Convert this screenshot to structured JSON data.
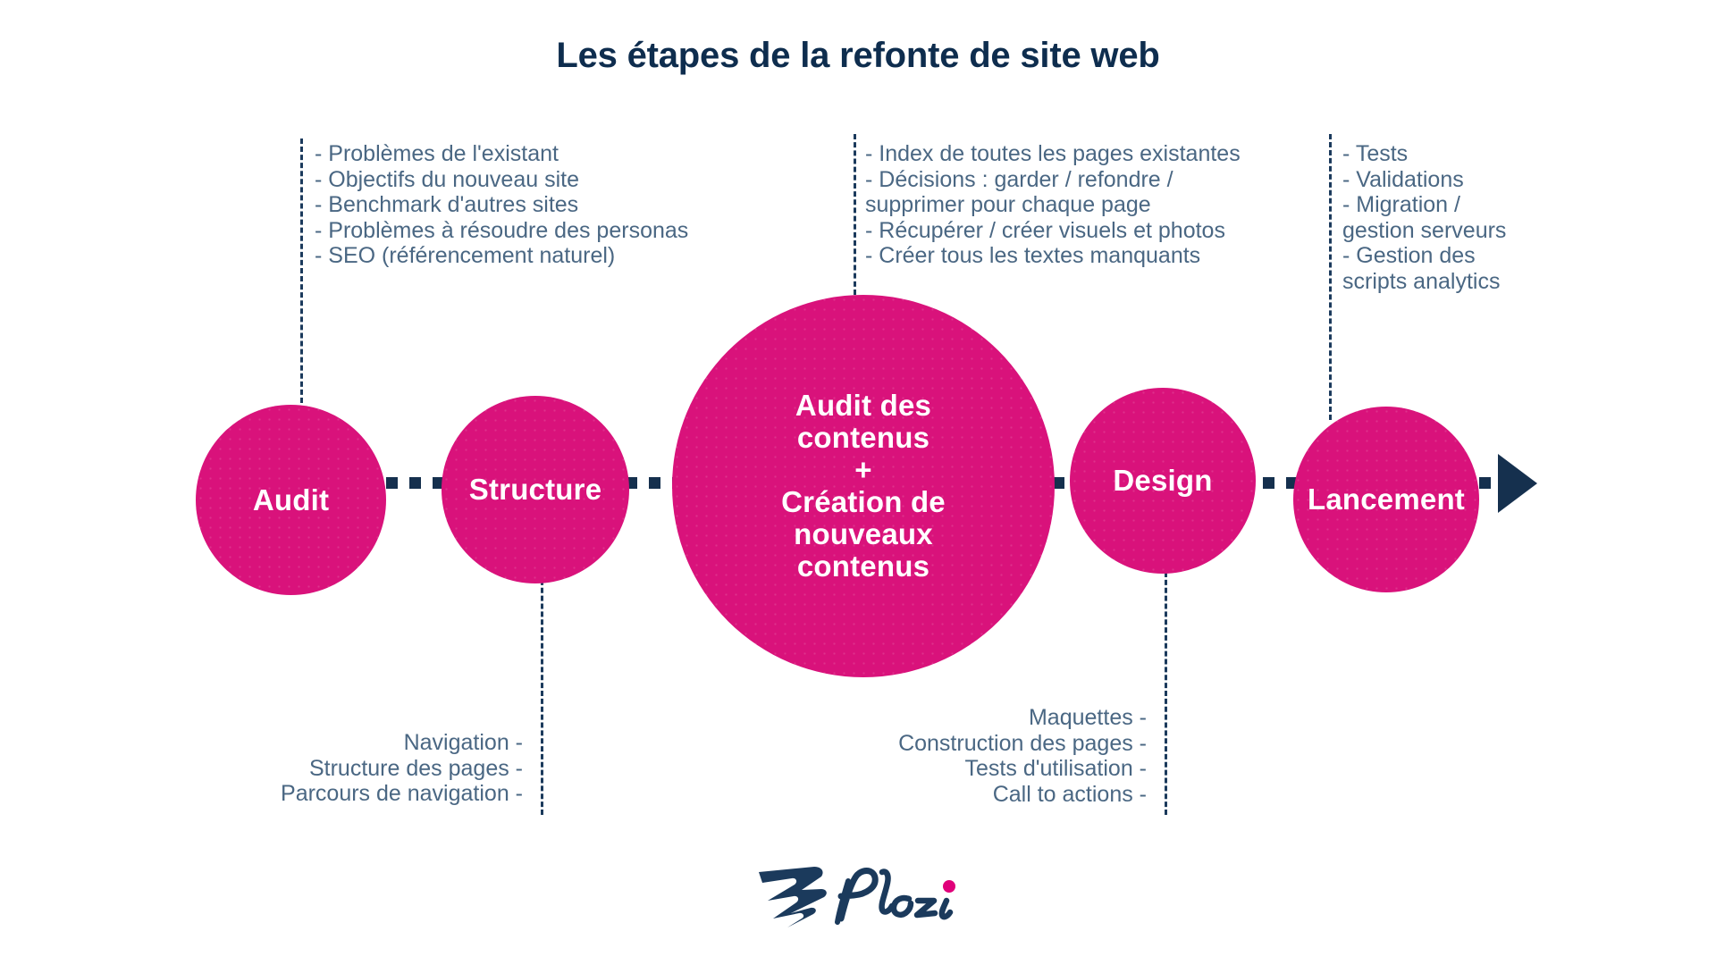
{
  "page": {
    "title": "Les étapes de la refonte de site web",
    "background_color": "#ffffff"
  },
  "colors": {
    "accent_pink": "#d9127b",
    "navy": "#15304e",
    "title_navy": "#0e2d4e",
    "note_text": "#4a6783"
  },
  "steps": [
    {
      "id": "audit",
      "label": "Audit",
      "size": "small"
    },
    {
      "id": "structure",
      "label": "Structure",
      "size": "small"
    },
    {
      "id": "contenus",
      "label": "Audit des\ncontenus\n+\nCréation de\nnouveaux\ncontenus",
      "size": "big"
    },
    {
      "id": "design",
      "label": "Design",
      "size": "small"
    },
    {
      "id": "lancement",
      "label": "Lancement",
      "size": "small"
    }
  ],
  "notes": {
    "audit": {
      "position": "above",
      "align": "left",
      "text": "- Problèmes de l'existant\n- Objectifs du nouveau site\n- Benchmark d'autres sites\n- Problèmes à résoudre des personas\n- SEO (référencement naturel)",
      "items": [
        "- Problèmes de l'existant",
        "- Objectifs du nouveau site",
        "- Benchmark d'autres sites",
        "- Problèmes à résoudre des personas",
        "- SEO (référencement naturel)"
      ]
    },
    "structure": {
      "position": "below",
      "align": "right",
      "text": "Navigation -\nStructure des pages -\nParcours de navigation -",
      "items": [
        "Navigation -",
        "Structure des pages -",
        "Parcours de navigation -"
      ]
    },
    "contenus": {
      "position": "above",
      "align": "left",
      "text": "- Index de toutes les pages existantes\n- Décisions : garder / refondre /\nsupprimer pour chaque page\n- Récupérer / créer visuels et photos\n- Créer tous les textes manquants",
      "items": [
        "- Index de toutes les pages existantes",
        "- Décisions : garder / refondre /",
        "supprimer pour chaque page",
        "- Récupérer / créer visuels et photos",
        "- Créer tous les textes manquants"
      ]
    },
    "design": {
      "position": "below",
      "align": "right",
      "text": "Maquettes -\nConstruction des pages -\nTests d'utilisation -\nCall to actions -",
      "items": [
        "Maquettes -",
        "Construction des pages -",
        "Tests d'utilisation -",
        "Call to actions -"
      ]
    },
    "lancement": {
      "position": "above",
      "align": "left",
      "text": "- Tests\n- Validations\n- Migration /\ngestion serveurs\n- Gestion des\nscripts analytics",
      "items": [
        "- Tests",
        "- Validations",
        "- Migration /",
        "gestion serveurs",
        "- Gestion des",
        "scripts analytics"
      ]
    }
  },
  "logo": {
    "brand": "Plezi",
    "mark": "plezi-bird-icon",
    "dot_color": "#e0007a",
    "wordmark_color": "#1b3a5c"
  }
}
